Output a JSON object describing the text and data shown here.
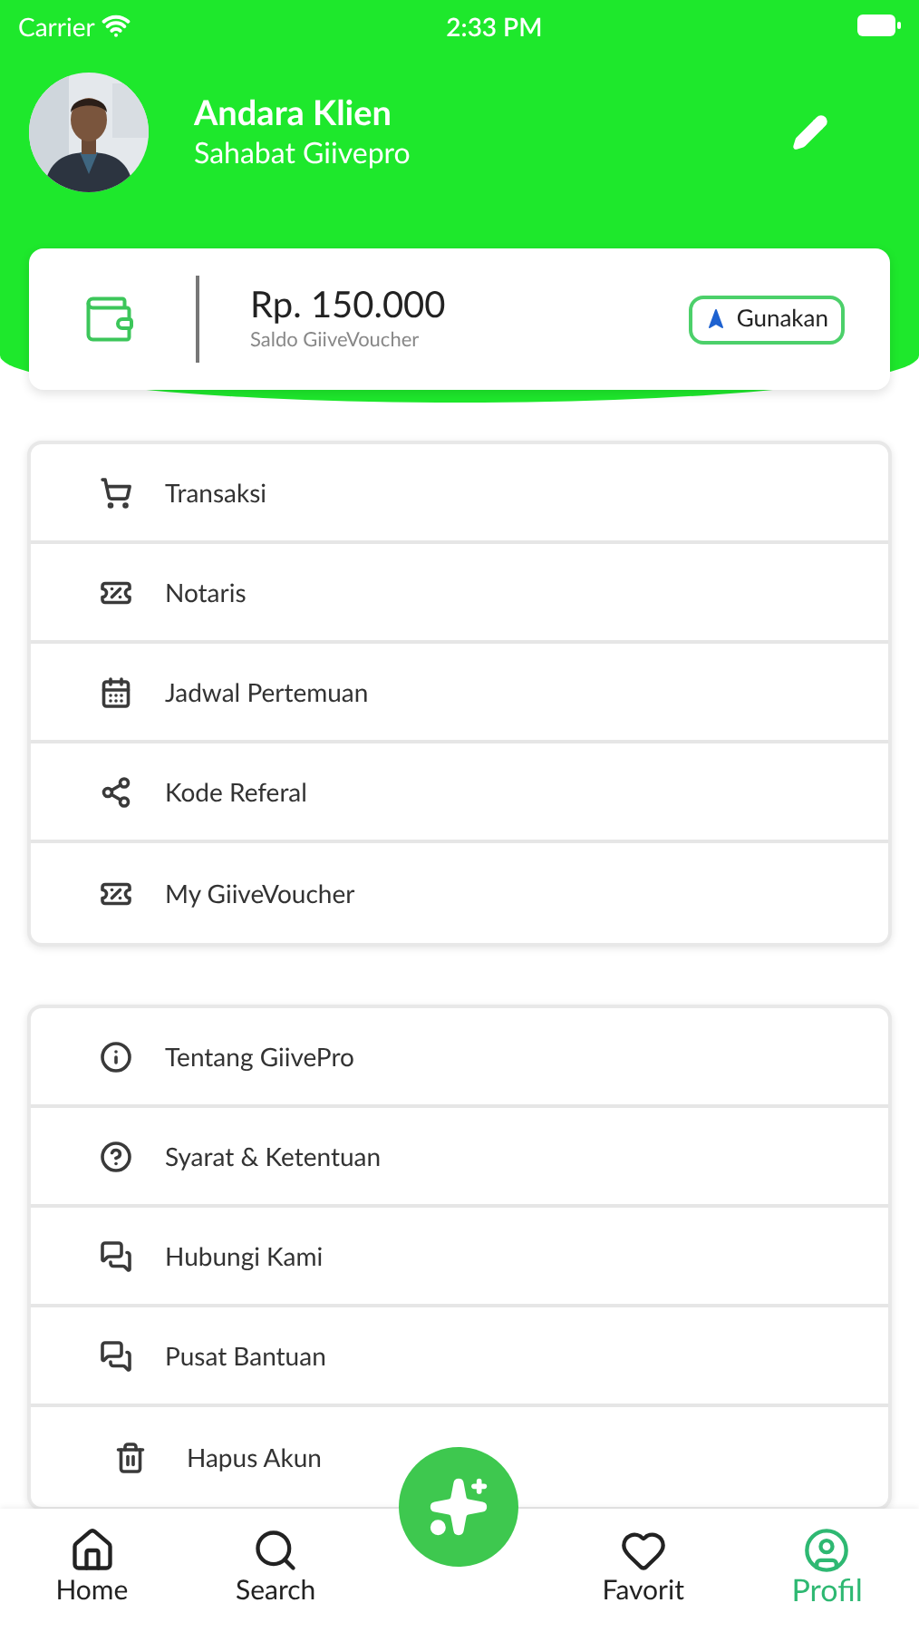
{
  "status_bar": {
    "carrier": "Carrier",
    "time": "2:33 PM"
  },
  "profile": {
    "name": "Andara Klien",
    "subtitle": "Sahabat Giivepro"
  },
  "balance": {
    "amount": "Rp. 150.000",
    "label": "Saldo GiiveVoucher",
    "button": "Gunakan"
  },
  "menu_groups": [
    {
      "items": [
        {
          "kind": "cart",
          "label": "Transaksi"
        },
        {
          "kind": "voucher",
          "label": "Notaris"
        },
        {
          "kind": "calendar",
          "label": "Jadwal Pertemuan"
        },
        {
          "kind": "share",
          "label": "Kode Referal"
        },
        {
          "kind": "voucher",
          "label": "My GiiveVoucher"
        }
      ]
    },
    {
      "items": [
        {
          "kind": "info",
          "label": "Tentang GiivePro"
        },
        {
          "kind": "help",
          "label": "Syarat & Ketentuan"
        },
        {
          "kind": "chat",
          "label": "Hubungi Kami"
        },
        {
          "kind": "chat",
          "label": "Pusat Bantuan"
        },
        {
          "kind": "delete",
          "label": "Hapus Akun"
        }
      ]
    }
  ],
  "tab_bar": [
    {
      "kind": "home",
      "label": "Home",
      "selected": false
    },
    {
      "kind": "search",
      "label": "Search",
      "selected": false
    },
    {
      "kind": "fab"
    },
    {
      "kind": "favorite",
      "label": "Favorit",
      "selected": false
    },
    {
      "kind": "profile",
      "label": "Profil",
      "selected": true
    }
  ]
}
